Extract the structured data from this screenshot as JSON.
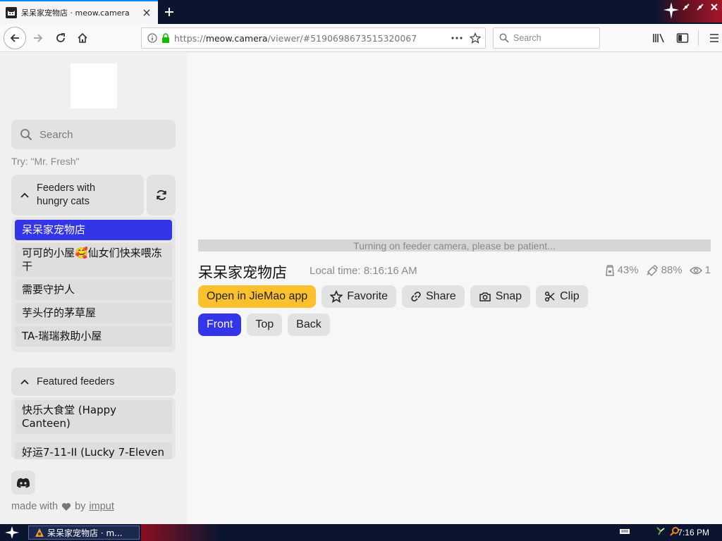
{
  "browser": {
    "tab_title": "呆呆家宠物店 · meow.camera",
    "url_host": "meow.camera",
    "url_path": "/viewer/#5190698673515320067",
    "url_scheme": "https://",
    "search_placeholder": "Search"
  },
  "sidebar": {
    "search_placeholder": "Search",
    "try_text": "Try: \"Mr. Fresh\"",
    "hungry_group_label": "Feeders with hungry cats",
    "hungry_feeders": [
      "呆呆家宠物店",
      "可可的小屋🥰仙女们快来喂冻干",
      "需要守护人",
      "芋头仔的茅草屋",
      "TA-瑞瑞救助小屋"
    ],
    "featured_group_label": "Featured feeders",
    "featured_feeders": [
      "快乐大食堂 (Happy Canteen)",
      "好运7-11-II (Lucky 7-Eleven"
    ],
    "made_with_prefix": "made with",
    "made_with_by": "by",
    "made_with_author": "imput"
  },
  "main": {
    "loading_text": "Turning on feeder camera, please be patient...",
    "feeder_title": "呆呆家宠物店",
    "local_time": "Local time: 8:16:16 AM",
    "stats": {
      "food": "43%",
      "battery": "88%",
      "viewers": "1"
    },
    "actions": {
      "open_app": "Open in JieMao app",
      "favorite": "Favorite",
      "share": "Share",
      "snap": "Snap",
      "clip": "Clip"
    },
    "cameras": [
      "Front",
      "Top",
      "Back"
    ]
  },
  "taskbar": {
    "task_title": "呆呆家宠物店 · m...",
    "clock": "7:16 PM"
  },
  "colors": {
    "accent_blue": "#3434e8",
    "accent_yellow": "#fbc02d",
    "secure_green": "#12bc00"
  }
}
